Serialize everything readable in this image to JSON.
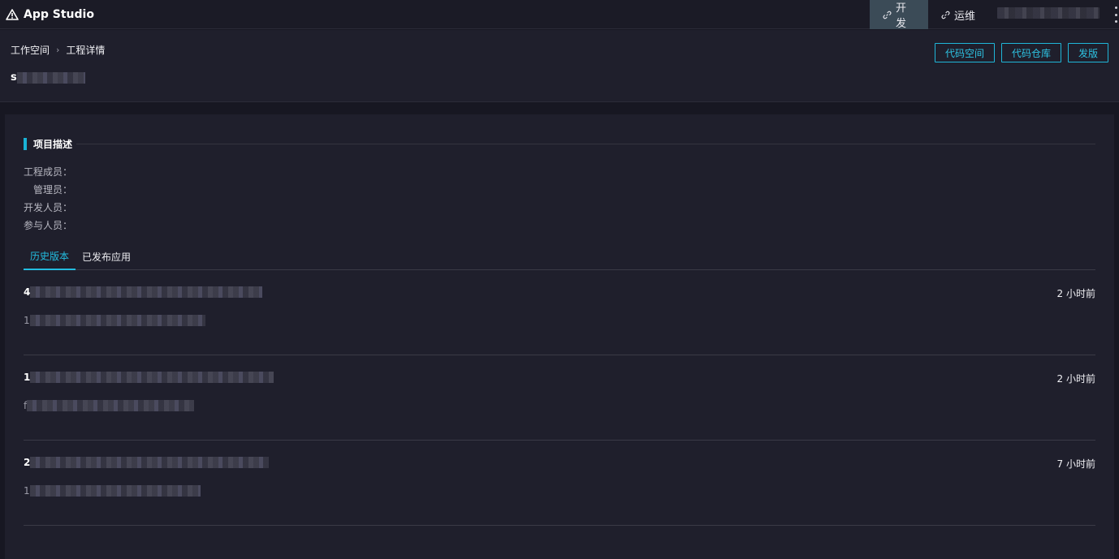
{
  "app": {
    "title": "App Studio",
    "logo_icon": "warning-triangle-icon"
  },
  "nav": {
    "tabs": [
      {
        "label": "开发",
        "icon": "link-icon",
        "active": true
      },
      {
        "label": "运维",
        "icon": "link-icon",
        "active": false
      }
    ],
    "user_menu_icon": "more-vertical-icon"
  },
  "breadcrumb": {
    "items": [
      "工作空间",
      "工程详情"
    ],
    "separator": "›"
  },
  "project": {
    "name_prefix": "s"
  },
  "header_buttons": {
    "code_space": "代码空间",
    "code_repo": "代码仓库",
    "publish": "发版"
  },
  "description": {
    "title": "项目描述",
    "fields": [
      {
        "label": "工程成员："
      },
      {
        "label": "管理员："
      },
      {
        "label": "开发人员："
      },
      {
        "label": "参与人员："
      }
    ]
  },
  "tabs": {
    "history": "历史版本",
    "published": "已发布应用"
  },
  "versions": [
    {
      "title_prefix": "4",
      "desc_prefix": "1",
      "time": "2 小时前"
    },
    {
      "title_prefix": "1",
      "desc_prefix": "f",
      "time": "2 小时前"
    },
    {
      "title_prefix": "2",
      "desc_prefix": "1",
      "time": "7 小时前"
    }
  ],
  "colors": {
    "accent": "#1fb6d8",
    "background": "#171722",
    "panel": "#1f1f2c",
    "active_nav": "#3b4b57"
  }
}
